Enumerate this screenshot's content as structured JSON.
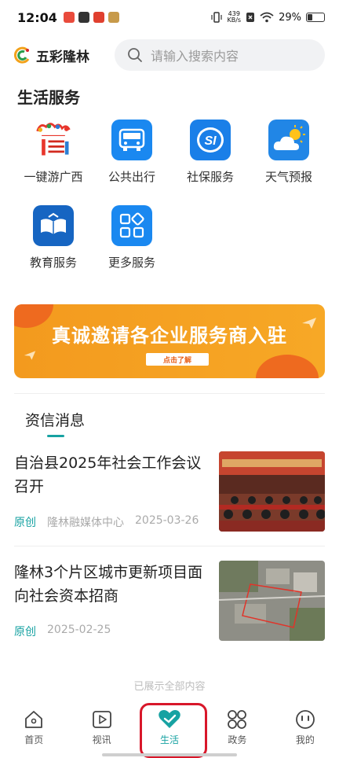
{
  "status_bar": {
    "time": "12:04",
    "net_speed_value": "439",
    "net_speed_unit": "KB/s",
    "battery": "29%"
  },
  "header": {
    "app_name": "五彩隆林",
    "search_placeholder": "请输入搜索内容"
  },
  "services": {
    "title": "生活服务",
    "items": [
      {
        "label": "一键游广西",
        "icon": "tourism-logo-icon"
      },
      {
        "label": "公共出行",
        "icon": "bus-icon"
      },
      {
        "label": "社保服务",
        "icon": "social-security-icon"
      },
      {
        "label": "天气预报",
        "icon": "weather-icon"
      },
      {
        "label": "教育服务",
        "icon": "open-book-icon"
      },
      {
        "label": "更多服务",
        "icon": "grid-more-icon"
      }
    ]
  },
  "banner": {
    "title": "真诚邀请各企业服务商入驻",
    "button": "点击了解"
  },
  "news": {
    "title": "资信消息",
    "items": [
      {
        "headline": "自治县2025年社会工作会议召开",
        "tag": "原创",
        "source": "隆林融媒体中心",
        "date": "2025-03-26"
      },
      {
        "headline": "隆林3个片区城市更新项目面向社会资本招商",
        "tag": "原创",
        "source": "",
        "date": "2025-02-25"
      }
    ],
    "end_text": "已展示全部内容"
  },
  "tabbar": {
    "items": [
      {
        "label": "首页"
      },
      {
        "label": "视讯"
      },
      {
        "label": "生活"
      },
      {
        "label": "政务"
      },
      {
        "label": "我的"
      }
    ],
    "active_index": 2
  },
  "colors": {
    "accent": "#17a2a2",
    "banner": "#f39a1e",
    "highlight": "#d8172a"
  }
}
